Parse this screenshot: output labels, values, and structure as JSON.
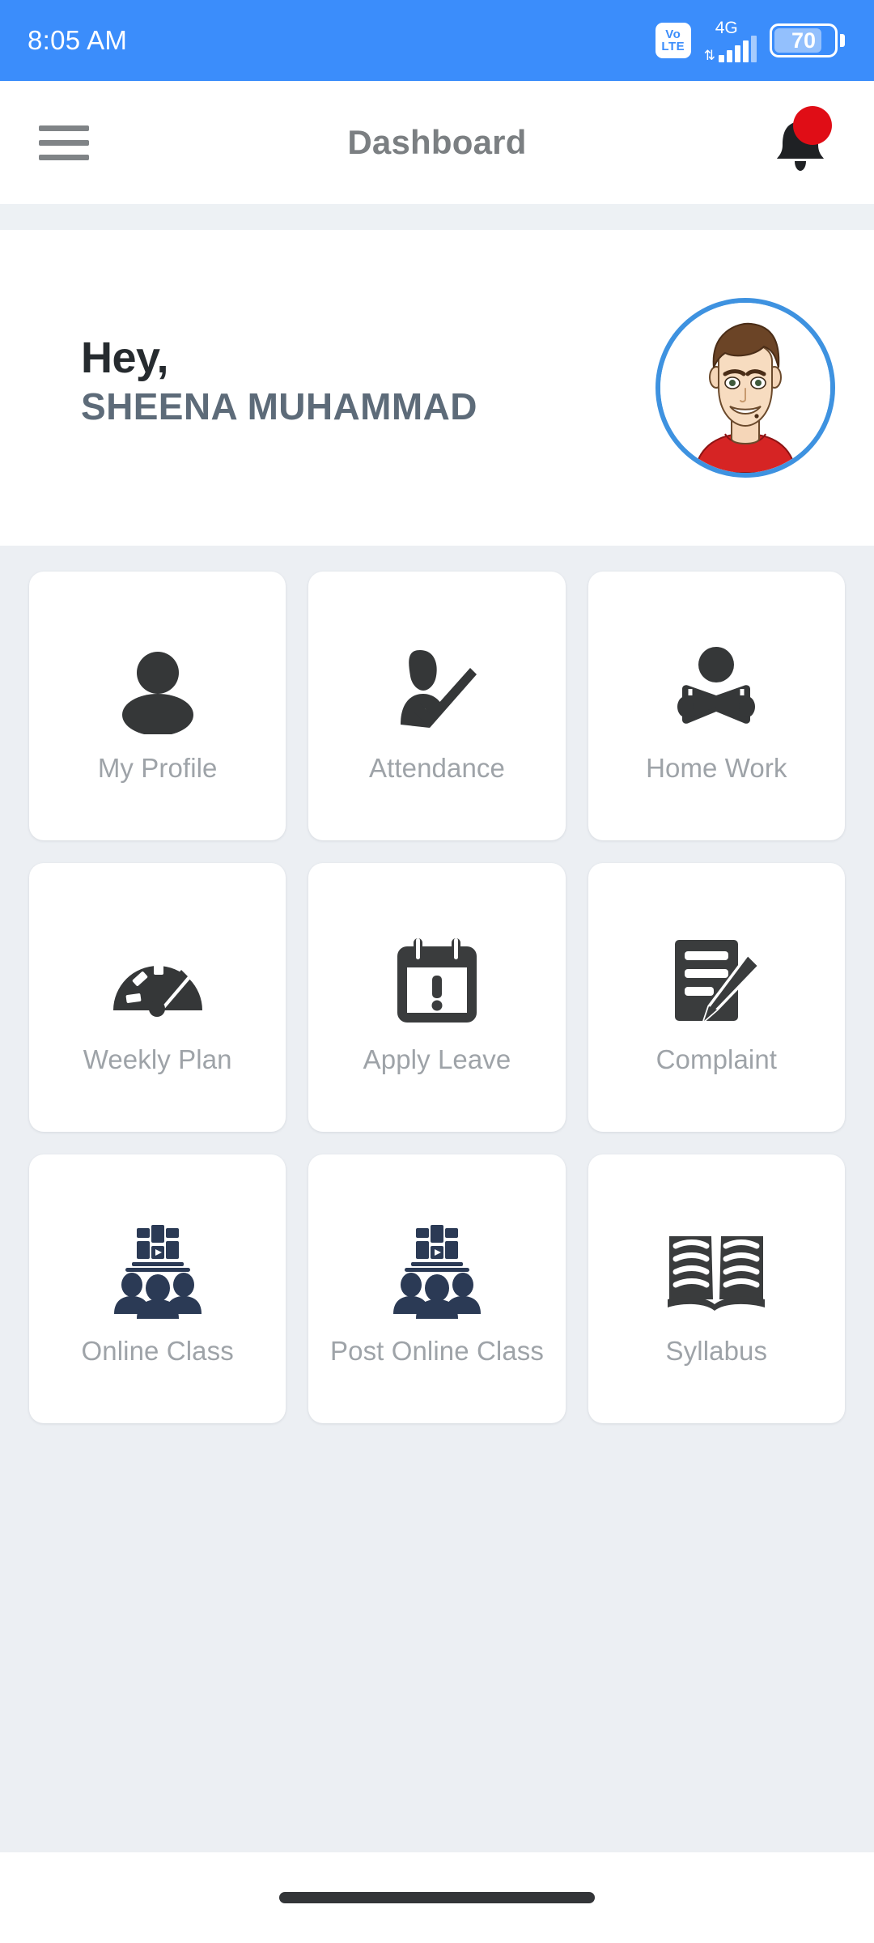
{
  "status_bar": {
    "time": "8:05 AM",
    "volte_top": "Vo",
    "volte_bottom": "LTE",
    "network": "4G",
    "battery_level": "70",
    "accent_color": "#3b8dfb"
  },
  "app_bar": {
    "menu_icon": "hamburger-menu-icon",
    "title": "Dashboard",
    "notification_icon": "bell-icon",
    "notification_badge_color": "#e00d16"
  },
  "greeting": {
    "salutation": "Hey,",
    "user_name": "SHEENA MUHAMMAD",
    "avatar_icon": "user-avatar-illustration",
    "avatar_ring_color": "#3e92e0"
  },
  "menu_grid": {
    "items": [
      {
        "label": "My Profile",
        "icon": "person-icon"
      },
      {
        "label": "Attendance",
        "icon": "person-check-icon"
      },
      {
        "label": "Home Work",
        "icon": "person-reading-book-icon"
      },
      {
        "label": "Weekly Plan",
        "icon": "speedometer-gauge-icon"
      },
      {
        "label": "Apply Leave",
        "icon": "calendar-alert-icon"
      },
      {
        "label": "Complaint",
        "icon": "document-pencil-icon"
      },
      {
        "label": "Online Class",
        "icon": "online-class-people-icon"
      },
      {
        "label": "Post Online Class",
        "icon": "online-class-people-icon"
      },
      {
        "label": "Syllabus",
        "icon": "open-book-icon"
      }
    ]
  },
  "navigation_bar": {
    "gesture_pill": "home-gesture-pill"
  }
}
